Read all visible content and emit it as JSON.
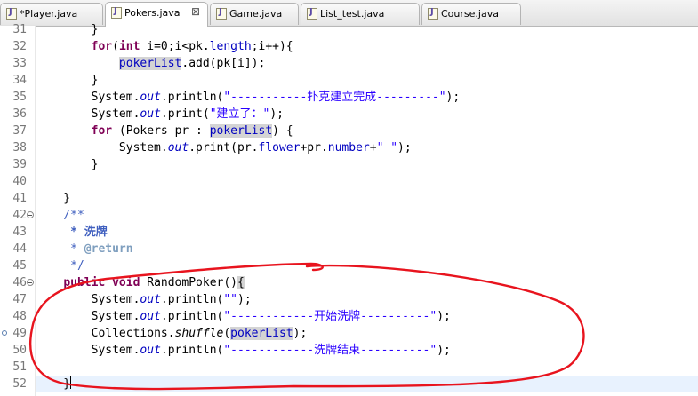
{
  "tabs": [
    {
      "label": "*Player.java",
      "active": false
    },
    {
      "label": "Pokers.java",
      "active": true,
      "close": "⊠"
    },
    {
      "label": "Game.java",
      "active": false
    },
    {
      "label": "List_test.java",
      "active": false
    },
    {
      "label": "Course.java",
      "active": false
    }
  ],
  "editor": {
    "line_numbers": [
      "31",
      "32",
      "33",
      "34",
      "35",
      "36",
      "37",
      "38",
      "39",
      "40",
      "41",
      "42",
      "43",
      "44",
      "45",
      "46",
      "47",
      "48",
      "49",
      "50",
      "51",
      "52"
    ],
    "code": {
      "l31": "        }",
      "l32_for": "for",
      "l32_int": "int",
      "l32_a": " i=0;i<pk.",
      "l32_length": "length",
      "l32_b": ";i++){",
      "l33_list": "pokerList",
      "l33_b": ".add(pk[i]);",
      "l34": "        }",
      "l35_a": "System.",
      "l35_out": "out",
      "l35_b": ".println(",
      "l35_str": "\"-----------扑克建立完成---------\"",
      "l35_c": ");",
      "l36_a": "System.",
      "l36_out": "out",
      "l36_b": ".print(",
      "l36_str": "\"建立了：\"",
      "l36_c": ");",
      "l37_for": "for",
      "l37_a": " (Pokers ",
      "l37_pr": "pr",
      "l37_b": " : ",
      "l37_list": "pokerList",
      "l37_c": ") {",
      "l38_a": "System.",
      "l38_out": "out",
      "l38_b": ".print(",
      "l38_pr1": "pr",
      "l38_dot1": ".",
      "l38_flower": "flower",
      "l38_plus": "+",
      "l38_pr2": "pr",
      "l38_dot2": ".",
      "l38_number": "number",
      "l38_plus2": "+",
      "l38_str": "\" \"",
      "l38_c": ");",
      "l39": "        }",
      "l41": "    }",
      "l42": "/**",
      "l43": " * 洗牌",
      "l44_a": " * ",
      "l44_tag": "@return",
      "l45": " */",
      "l46_public": "public",
      "l46_void": "void",
      "l46_rest": " RandomPoker()",
      "l46_brace": "{",
      "l47_a": "System.",
      "l47_out": "out",
      "l47_b": ".println(",
      "l47_str": "\"\"",
      "l47_c": ");",
      "l48_a": "System.",
      "l48_out": "out",
      "l48_b": ".println(",
      "l48_str": "\"------------开始洗牌----------\"",
      "l48_c": ");",
      "l49_a": "Collections.",
      "l49_method": "shuffle",
      "l49_b": "(",
      "l49_list": "pokerList",
      "l49_c": ");",
      "l50_a": "System.",
      "l50_out": "out",
      "l50_b": ".println(",
      "l50_str": "\"------------洗牌结束----------\"",
      "l50_c": ");",
      "l52": "    }"
    }
  },
  "colors": {
    "annotation": "#e8141e",
    "keyword": "#7f0055",
    "field": "#0000c0",
    "string": "#2a00ff",
    "javadoc": "#3f5fbf"
  }
}
